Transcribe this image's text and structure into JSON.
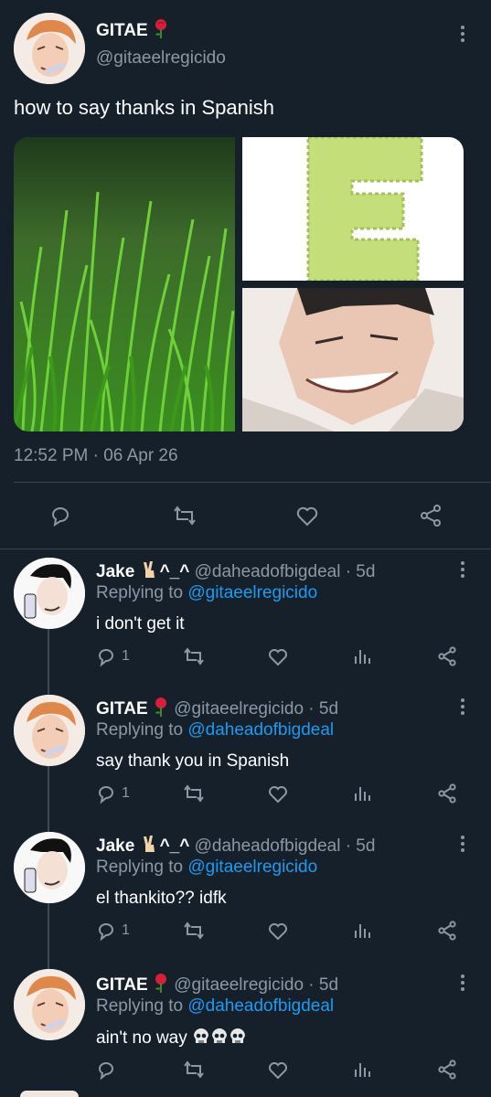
{
  "main_tweet": {
    "name": "GITAE",
    "handle": "@gitaeelregicido",
    "text": "how to say thanks in Spanish",
    "timestamp": "12:52 PM · 06 Apr 26",
    "images": [
      "grass-photo",
      "letter-e-image",
      "smirking-man-illustration"
    ]
  },
  "replies": [
    {
      "name": "Jake",
      "name_suffix": "^_^",
      "handle": "@daheadofbigdeal · 5d",
      "replying_prefix": "Replying to",
      "replying_to": "@gitaeelregicido",
      "text": "i don't get it",
      "reply_count": "1"
    },
    {
      "name": "GITAE",
      "handle": "@gitaeelregicido · 5d",
      "replying_prefix": "Replying to",
      "replying_to": "@daheadofbigdeal",
      "text": "say thank you in Spanish",
      "reply_count": "1"
    },
    {
      "name": "Jake",
      "name_suffix": "^_^",
      "handle": "@daheadofbigdeal · 5d",
      "replying_prefix": "Replying to",
      "replying_to": "@gitaeelregicido",
      "text": "el thankito?? idfk",
      "reply_count": "1"
    },
    {
      "name": "GITAE",
      "handle": "@gitaeelregicido · 5d",
      "replying_prefix": "Replying to",
      "replying_to": "@daheadofbigdeal",
      "text": "ain't no way",
      "reply_count": ""
    }
  ],
  "colors": {
    "background": "#15202b",
    "accent": "#1d9bf0",
    "muted": "#8b98a5"
  }
}
